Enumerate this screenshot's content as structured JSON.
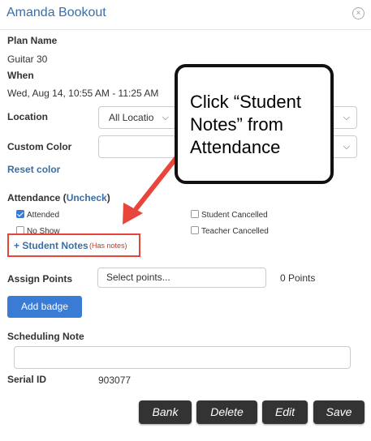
{
  "dialog": {
    "title": "Amanda Bookout",
    "close_icon": "close-circle-icon"
  },
  "plan": {
    "label": "Plan Name",
    "value": "Guitar 30"
  },
  "when": {
    "label": "When",
    "value": "Wed, Aug 14, 10:55 AM - 11:25 AM"
  },
  "location": {
    "label": "Location",
    "selected": "All Locatio"
  },
  "custom_color": {
    "label": "Custom Color",
    "selected": "",
    "reset_label": "Reset color"
  },
  "attendance": {
    "label": "Attendance (",
    "uncheck_label": "Uncheck",
    "label_close": ")",
    "options": [
      {
        "label": "Attended",
        "checked": true
      },
      {
        "label": "Student Cancelled",
        "checked": false
      },
      {
        "label": "No Show",
        "checked": false
      },
      {
        "label": "Teacher Cancelled",
        "checked": false
      }
    ]
  },
  "student_notes": {
    "label": "+ Student Notes",
    "sub": "(Has notes)"
  },
  "assign_points": {
    "label": "Assign Points",
    "placeholder": "Select points...",
    "points": "0 Points"
  },
  "add_badge_label": "Add badge",
  "scheduling_note": {
    "label": "Scheduling Note",
    "value": ""
  },
  "serial": {
    "label": "Serial ID",
    "value": "903077"
  },
  "footer": {
    "bank": "Bank",
    "delete": "Delete",
    "edit": "Edit",
    "save": "Save"
  },
  "callout": {
    "text": "Click “Student\nNotes” from\nAttendance"
  },
  "colors": {
    "accent": "#3a6ea5",
    "button_blue": "#3a7bd5",
    "annotation_red": "#e8453c",
    "footer_button": "#333333"
  }
}
